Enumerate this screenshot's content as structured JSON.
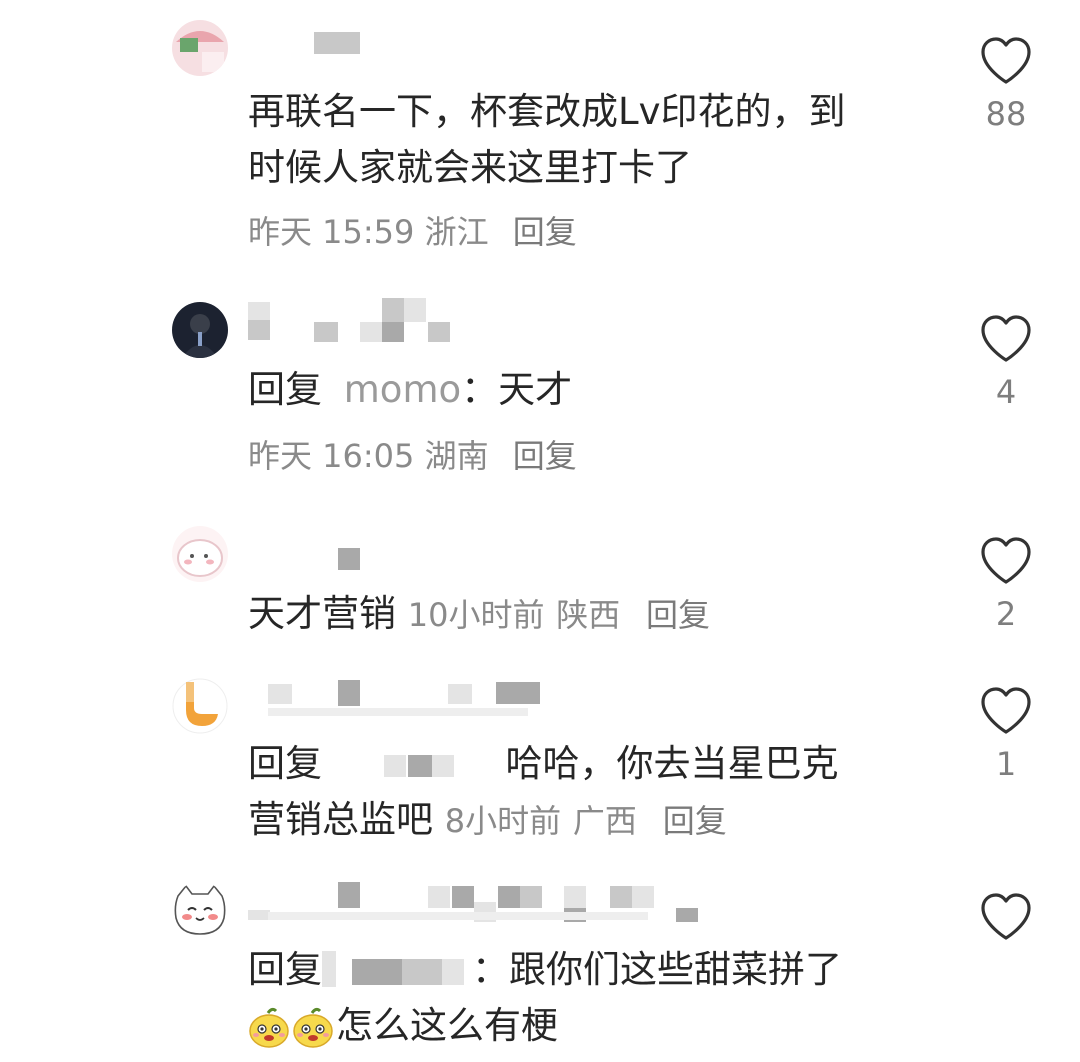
{
  "comments": [
    {
      "text_line1": "再联名一下，杯套改成Lv印花的，到",
      "text_line2": "时候人家就会来这里打卡了",
      "time": "昨天 15:59",
      "region": "浙江",
      "reply": "回复",
      "likes": "88"
    },
    {
      "reply_prefix": "回复",
      "mention": "momo",
      "colon": "：",
      "text": "天才",
      "time": "昨天 16:05",
      "region": "湖南",
      "reply": "回复",
      "likes": "4"
    },
    {
      "text": "天才营销",
      "time": "10小时前",
      "region": "陕西",
      "reply": "回复",
      "likes": "2"
    },
    {
      "reply_prefix": "回复",
      "text_line1": "哈哈，你去当星巴克",
      "text_line2": "营销总监吧",
      "time": "8小时前",
      "region": "广西",
      "reply": "回复",
      "likes": "1"
    },
    {
      "reply_prefix": "回复",
      "colon": "：",
      "text_line1": "跟你们这些甜菜拼了",
      "text_line2": "怎么这么有梗",
      "likes": ""
    }
  ],
  "icons": {
    "like": "heart-outline-icon",
    "emoji": "yellow-face-emoji"
  },
  "colors": {
    "text": "#262626",
    "meta": "#8a8a8a",
    "heart": "#333333"
  }
}
